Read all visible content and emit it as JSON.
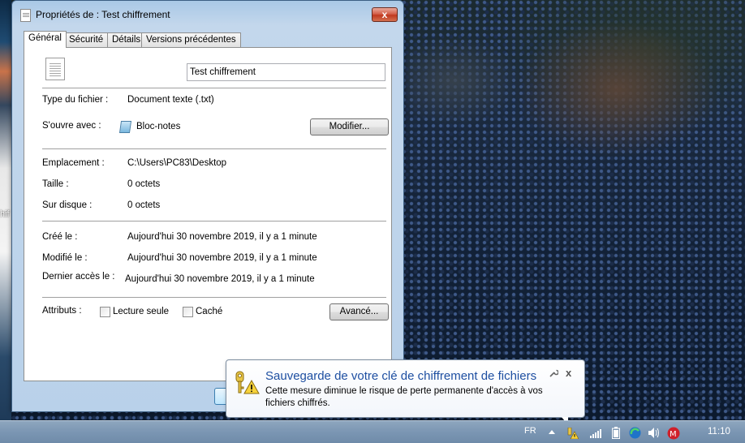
{
  "window": {
    "title": "Propriétés de : Test chiffrement",
    "close_glyph": "x"
  },
  "tabs": [
    {
      "label": "Général",
      "active": true
    },
    {
      "label": "Sécurité",
      "active": false
    },
    {
      "label": "Détails",
      "active": false
    },
    {
      "label": "Versions précédentes",
      "active": false
    }
  ],
  "general": {
    "filename": "Test chiffrement",
    "file_type_label": "Type du fichier :",
    "file_type_value": "Document texte (.txt)",
    "opens_with_label": "S'ouvre avec :",
    "opens_with_value": "Bloc-notes",
    "modify_button": "Modifier...",
    "location_label": "Emplacement :",
    "location_value": "C:\\Users\\PC83\\Desktop",
    "size_label": "Taille :",
    "size_value": "0 octets",
    "disk_size_label": "Sur disque :",
    "disk_size_value": "0 octets",
    "created_label": "Créé le :",
    "created_value": "Aujourd'hui 30 novembre 2019, il y a 1 minute",
    "modified_label": "Modifié le :",
    "modified_value": "Aujourd'hui 30 novembre 2019, il y a 1 minute",
    "accessed_label": "Dernier accès le :",
    "accessed_value": "Aujourd'hui 30 novembre 2019, il y a 1 minute",
    "attributes_label": "Attributs :",
    "readonly_label": "Lecture seule",
    "readonly_checked": false,
    "hidden_label": "Caché",
    "hidden_checked": false,
    "advanced_button": "Avancé..."
  },
  "desktop": {
    "left_edge_text": "hif"
  },
  "balloon": {
    "title": "Sauvegarde de votre clé de chiffrement de fichiers",
    "body": "Cette mesure diminue le risque de perte permanente d'accès à vos fichiers chiffrés.",
    "close_glyph": "x"
  },
  "taskbar": {
    "language": "FR",
    "clock": "11:10",
    "tray_icons": [
      "show-hidden-icons-arrow-icon",
      "key-warning-icon",
      "network-signal-icon",
      "battery-icon",
      "browser-icon",
      "volume-icon",
      "antivirus-icon"
    ]
  },
  "colors": {
    "balloon_title": "#1e4fa1",
    "taskbar": "#7b96b3",
    "close_button": "#c0391f"
  }
}
